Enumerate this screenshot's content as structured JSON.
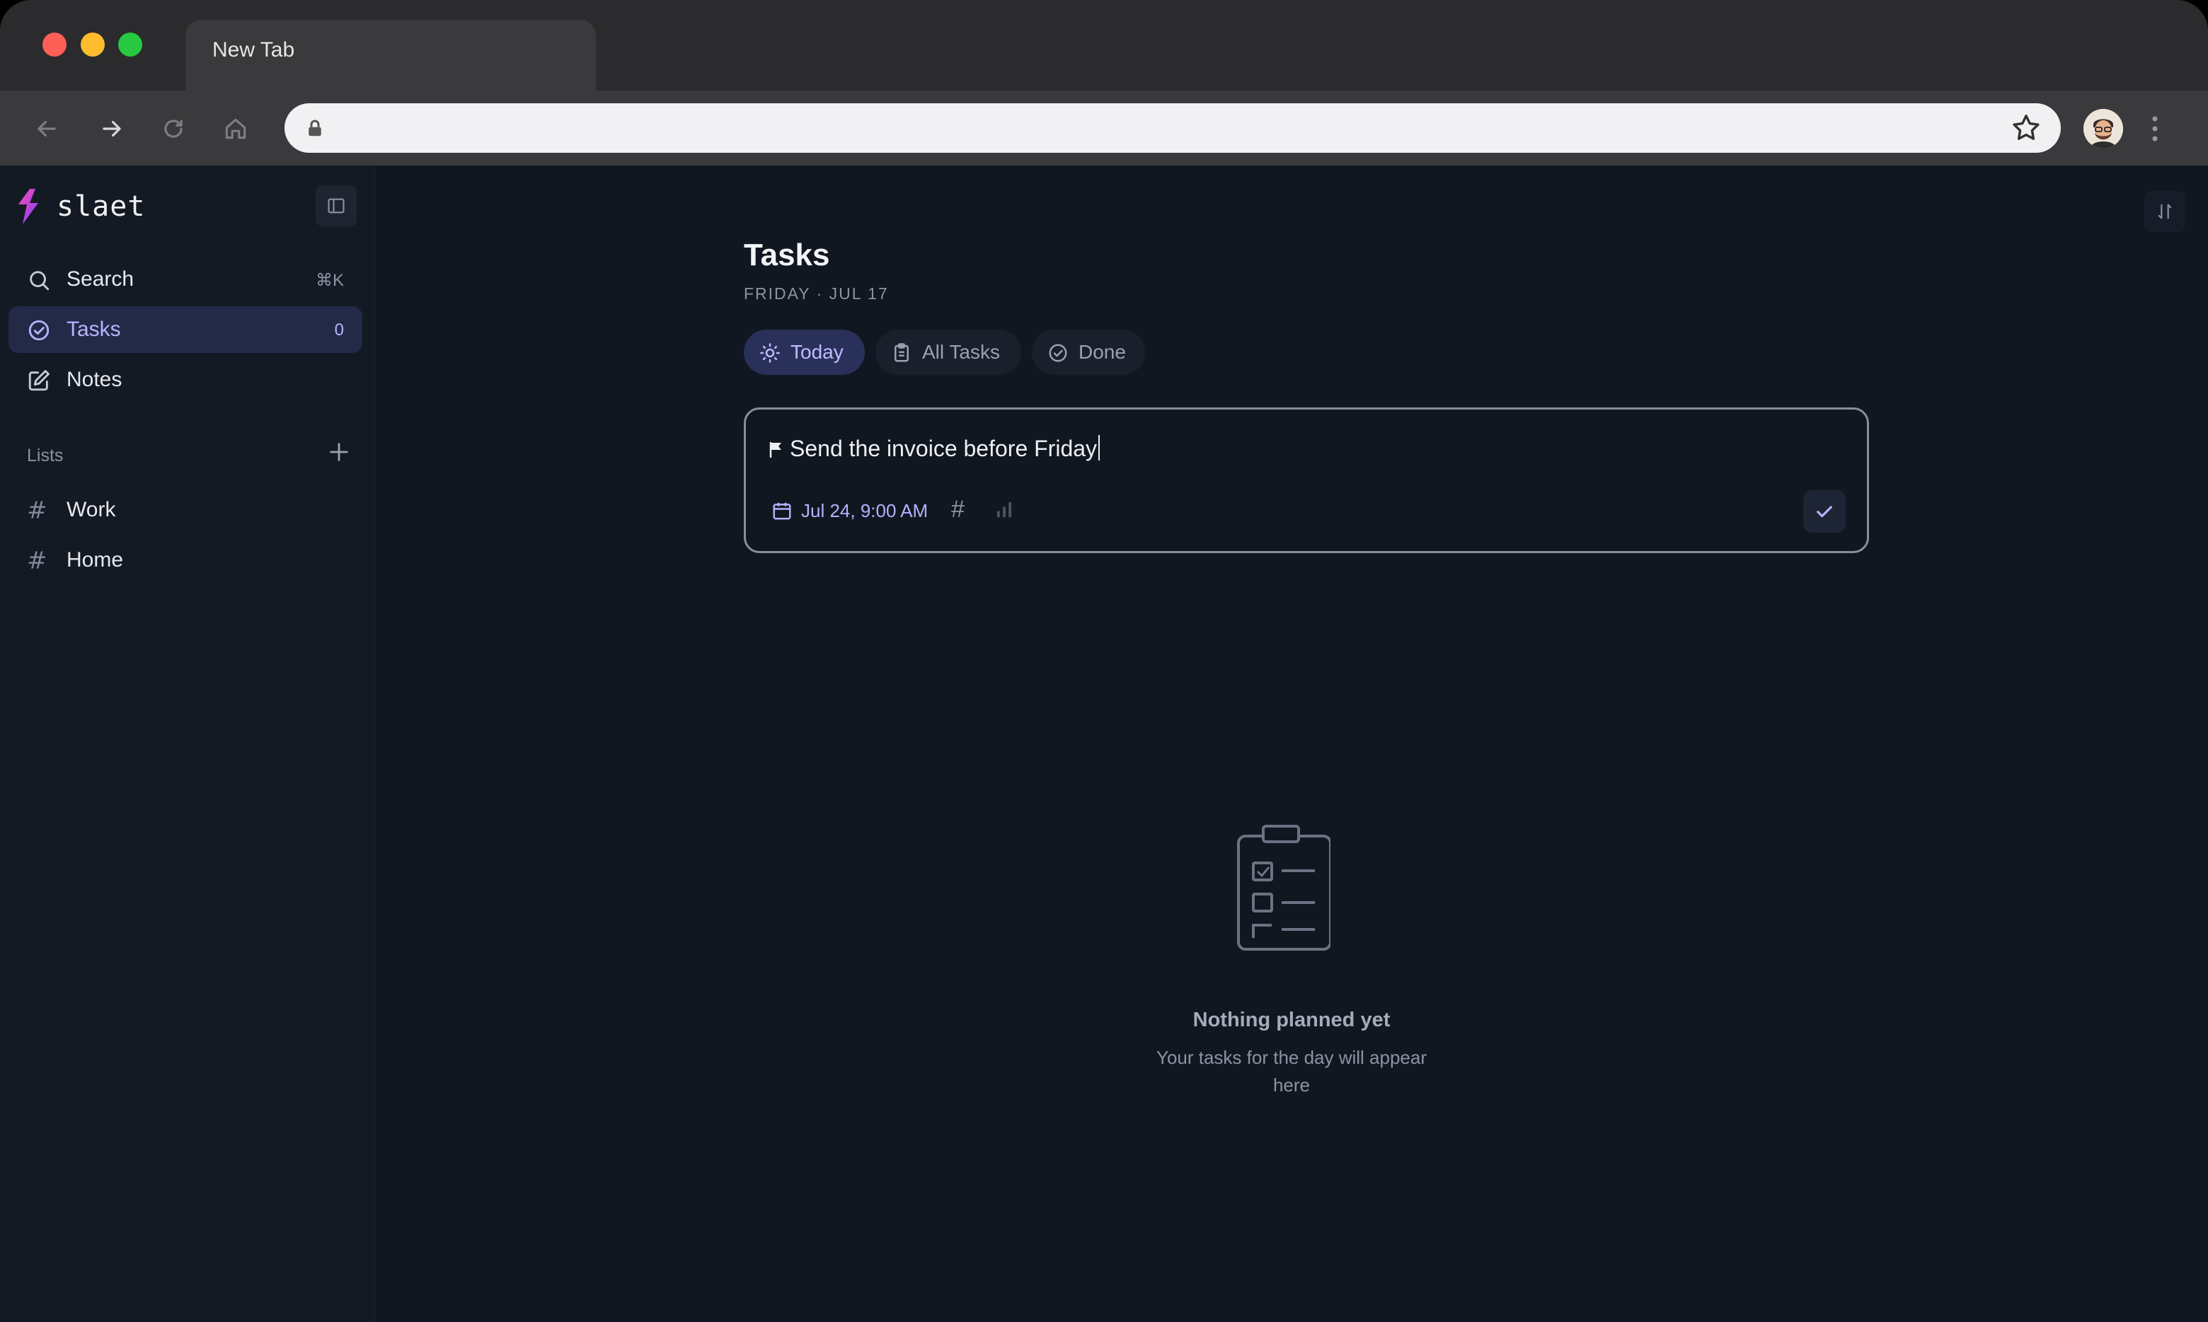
{
  "browser": {
    "tab_title": "New Tab",
    "address_value": "",
    "icons": [
      "back-icon",
      "forward-icon",
      "reload-icon",
      "home-icon",
      "lock-icon",
      "star-icon",
      "profile-avatar",
      "kebab-menu-icon"
    ]
  },
  "sidebar": {
    "brand": "slaet",
    "items": [
      {
        "label": "Search",
        "shortcut": "⌘K",
        "icon": "search-icon"
      },
      {
        "label": "Tasks",
        "count": "0",
        "icon": "check-circle-icon",
        "active": true
      },
      {
        "label": "Notes",
        "icon": "edit-note-icon"
      }
    ],
    "lists_heading": "Lists",
    "lists": [
      {
        "label": "Work"
      },
      {
        "label": "Home"
      }
    ]
  },
  "main": {
    "title": "Tasks",
    "date": "FRIDAY · JUL 17",
    "filters": [
      {
        "label": "Today",
        "icon": "sun-icon",
        "active": true
      },
      {
        "label": "All Tasks",
        "icon": "clipboard-icon"
      },
      {
        "label": "Done",
        "icon": "check-circle-icon"
      }
    ],
    "composer": {
      "text": "Send the invoice before Friday",
      "due": "Jul 24, 9:00 AM"
    },
    "empty": {
      "title": "Nothing planned yet",
      "subtitle": "Your tasks for the day will appear here"
    }
  },
  "colors": {
    "accent": "#b7b0ff",
    "active_bg": "#222a48",
    "app_bg": "#111720",
    "sidebar_bg": "#141a24"
  }
}
